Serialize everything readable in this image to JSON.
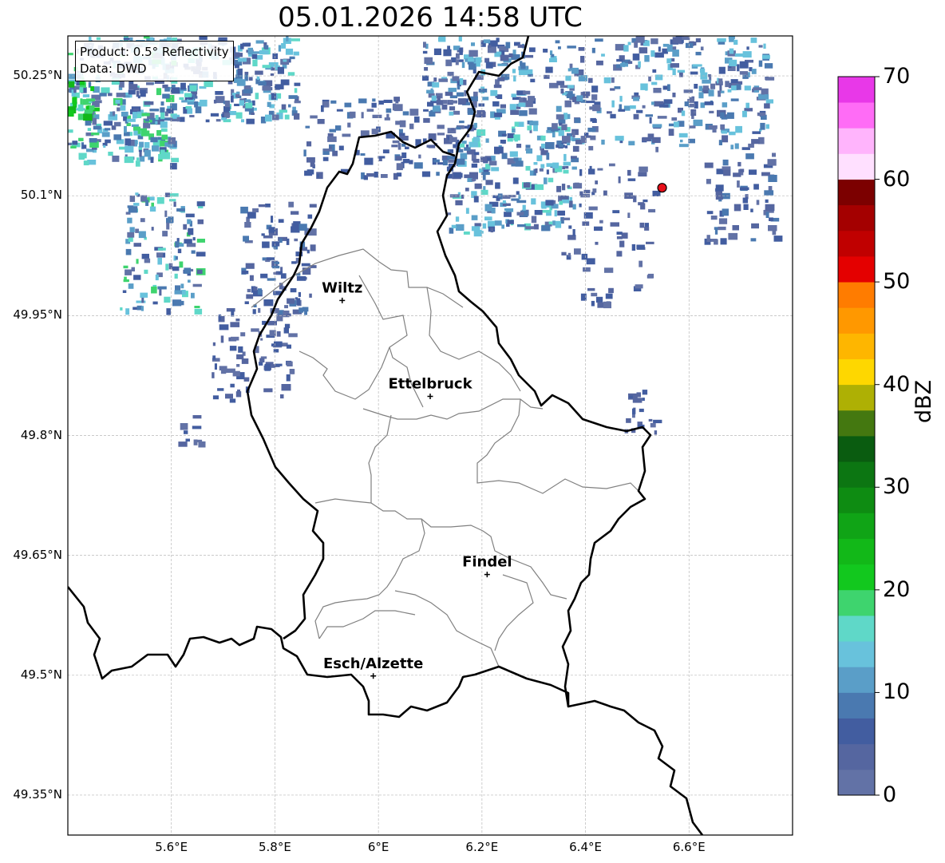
{
  "title": "05.01.2026 14:58 UTC",
  "info": {
    "product": "Product: 0.5° Reflectivity",
    "source": "Data: DWD"
  },
  "axes": {
    "lon_range": [
      5.4,
      6.8
    ],
    "lat_range": [
      49.3,
      50.3
    ],
    "x_ticks": [
      "5.6°E",
      "5.8°E",
      "6°E",
      "6.2°E",
      "6.4°E",
      "6.6°E"
    ],
    "y_ticks": [
      "50.25°N",
      "50.1°N",
      "49.95°N",
      "49.8°N",
      "49.65°N",
      "49.5°N",
      "49.35°N"
    ],
    "grid": true
  },
  "cities": [
    {
      "name": "Wiltz",
      "lon": 5.93,
      "lat": 49.969
    },
    {
      "name": "Ettelbruck",
      "lon": 6.1,
      "lat": 49.849
    },
    {
      "name": "Findel",
      "lon": 6.21,
      "lat": 49.626
    },
    {
      "name": "Esch/Alzette",
      "lon": 5.99,
      "lat": 49.499
    }
  ],
  "radar_site": {
    "lon": 6.548,
    "lat": 50.11,
    "color": "#e8101a"
  },
  "colorbar": {
    "label": "dBZ",
    "ticks": [
      "0",
      "10",
      "20",
      "30",
      "40",
      "50",
      "60",
      "70"
    ],
    "min": 0,
    "max": 70,
    "colors": [
      "#6272a6",
      "#5566a0",
      "#425da0",
      "#4a79b0",
      "#5a9ec8",
      "#68c2dc",
      "#5fd8c8",
      "#3ed46e",
      "#12c81e",
      "#12b818",
      "#10a416",
      "#0e8c12",
      "#0c7612",
      "#0a5c10",
      "#447810",
      "#aeb004",
      "#fed700",
      "#feb600",
      "#ff9800",
      "#ff7c00",
      "#e40000",
      "#c00000",
      "#a40000",
      "#7c0000",
      "#ffe0ff",
      "#ffb4fc",
      "#ff6cf6",
      "#e838e8"
    ]
  }
}
